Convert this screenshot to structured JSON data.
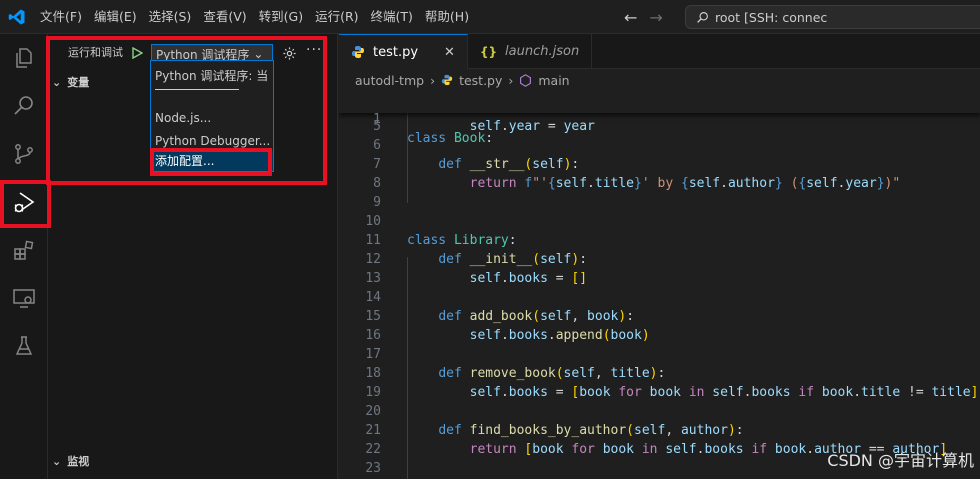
{
  "menubar": {
    "items": [
      "文件(F)",
      "编辑(E)",
      "选择(S)",
      "查看(V)",
      "转到(G)",
      "运行(R)",
      "终端(T)",
      "帮助(H)"
    ]
  },
  "command_center": {
    "text": "root [SSH: connec"
  },
  "activity_bar": {
    "items": [
      "explorer-icon",
      "search-icon",
      "source-control-icon",
      "run-debug-icon",
      "extensions-icon",
      "remote-explorer-icon",
      "testing-icon"
    ],
    "active": "run-debug-icon"
  },
  "sidebar": {
    "title": "运行和调试",
    "selected_config": "Python 调试程序",
    "sections": {
      "variables": "变量",
      "watch": "监视"
    },
    "dropdown": {
      "items": [
        "Python 调试程序: 当",
        "Node.js...",
        "Python Debugger...",
        "添加配置..."
      ],
      "separator": "——————————",
      "highlighted": "添加配置..."
    }
  },
  "tabs": [
    {
      "label": "test.py",
      "active": true,
      "icon": "python-icon"
    },
    {
      "label": "launch.json",
      "active": false,
      "icon": "json-braces-icon"
    }
  ],
  "breadcrumb": {
    "folder": "autodl-tmp",
    "file": "test.py",
    "symbol": "main"
  },
  "editor": {
    "sticky": {
      "number": "1",
      "text": "class Book:"
    },
    "lines": [
      {
        "n": "5",
        "text": "self.year = year"
      },
      {
        "n": "6",
        "text": ""
      },
      {
        "n": "7",
        "text": "def __str__(self):"
      },
      {
        "n": "8",
        "text": "return f\"'{self.title}' by {self.author} ({self.year})\""
      },
      {
        "n": "9",
        "text": ""
      },
      {
        "n": "10",
        "text": ""
      },
      {
        "n": "11",
        "text": "class Library:"
      },
      {
        "n": "12",
        "text": "def __init__(self):"
      },
      {
        "n": "13",
        "text": "self.books = []"
      },
      {
        "n": "14",
        "text": ""
      },
      {
        "n": "15",
        "text": "def add_book(self, book):"
      },
      {
        "n": "16",
        "text": "self.books.append(book)"
      },
      {
        "n": "17",
        "text": ""
      },
      {
        "n": "18",
        "text": "def remove_book(self, title):"
      },
      {
        "n": "19",
        "text": "self.books = [book for book in self.books if book.title != title]"
      },
      {
        "n": "20",
        "text": ""
      },
      {
        "n": "21",
        "text": "def find_books_by_author(self, author):"
      },
      {
        "n": "22",
        "text": "return [book for book in self.books if book.author == author]"
      },
      {
        "n": "23",
        "text": ""
      }
    ]
  },
  "watermark": "CSDN @宇宙计算机",
  "colors": {
    "highlight_box": "#e81123",
    "accent": "#0078d4",
    "selection": "#04395e"
  }
}
